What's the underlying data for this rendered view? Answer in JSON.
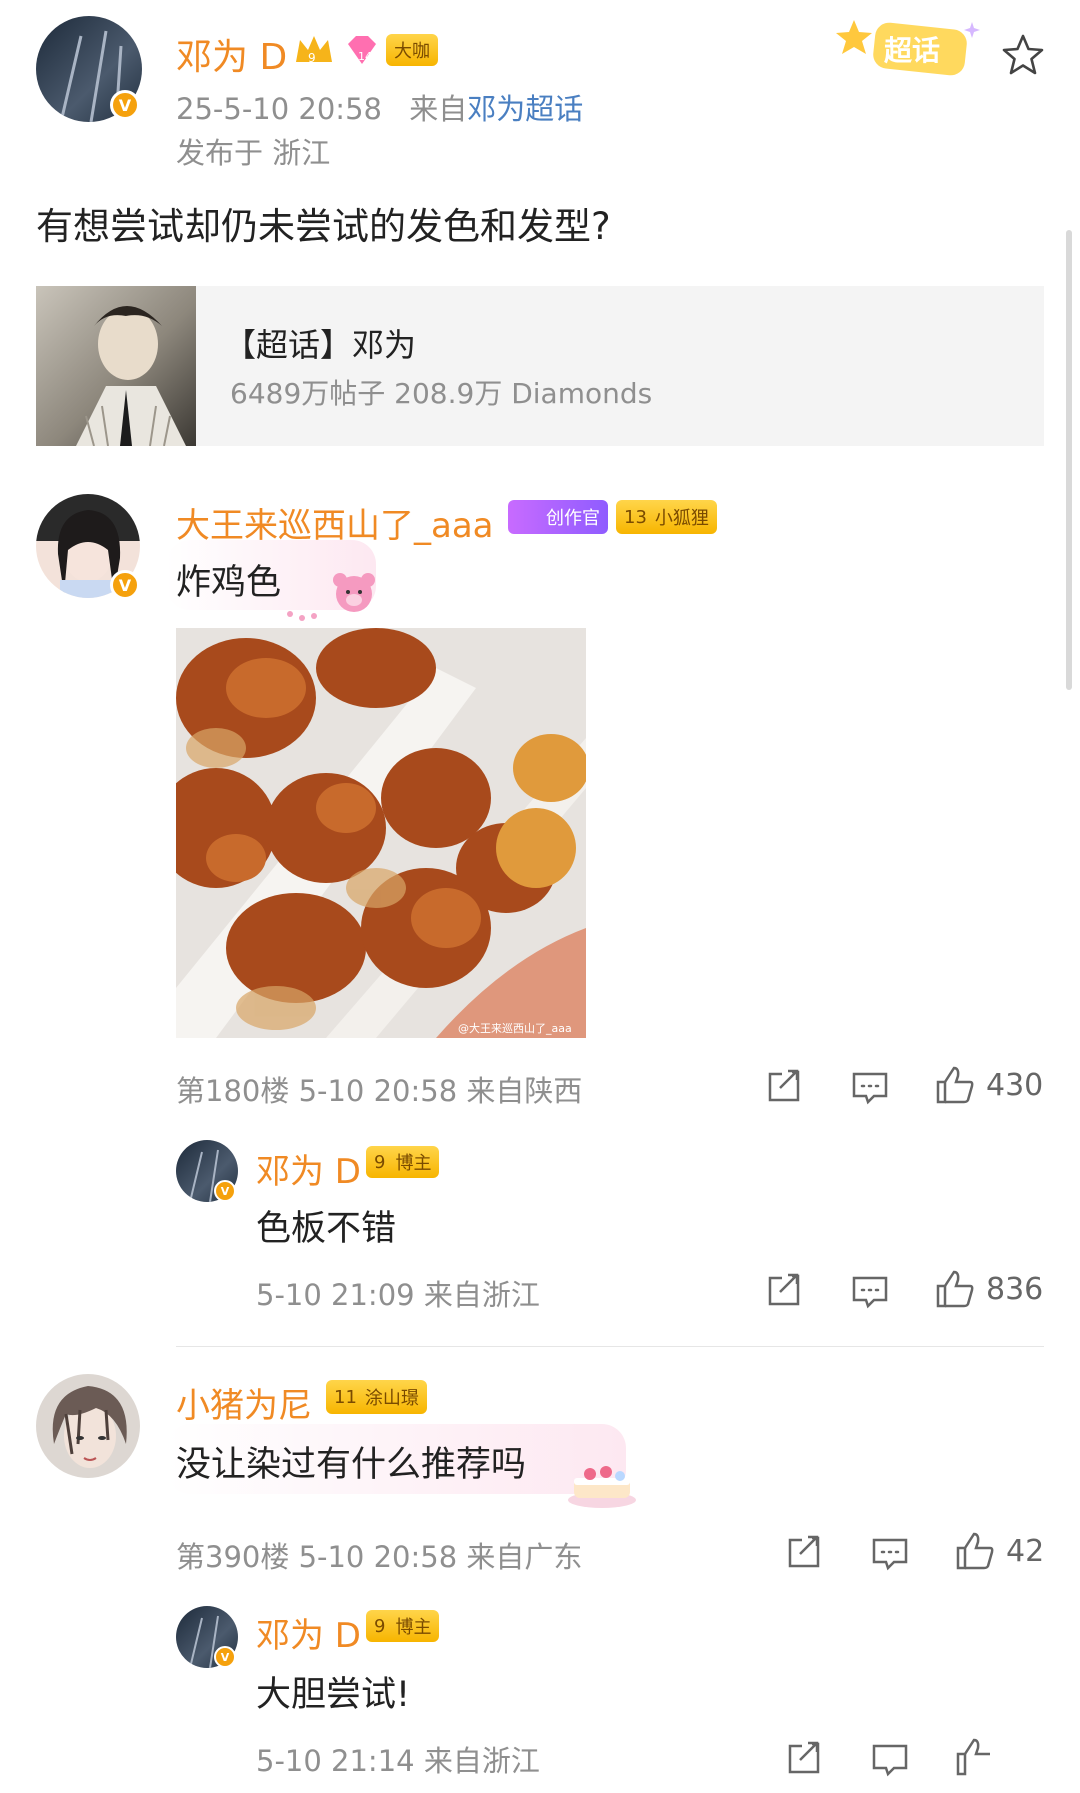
{
  "post": {
    "author": "邓为 D",
    "level_badge": "9",
    "member_badge": "14",
    "tag_badge": "大咖",
    "time": "25-5-10 20:58",
    "source_prefix": "来自",
    "source_link": "邓为超话",
    "published_at": "发布于 浙江",
    "supertopic_tag": "超话",
    "text": "有想尝试却仍未尝试的发色和发型?",
    "topic_card": {
      "title": "【超话】邓为",
      "stats": "6489万帖子 208.9万 Diamonds"
    }
  },
  "comments": [
    {
      "user": "大王来巡西山了_aaa",
      "badge1": "创作官",
      "badge2_level": "13",
      "badge2_label": "小狐狸",
      "text": "炸鸡色",
      "image_watermark": "@大王来巡西山了_aaa",
      "floor_info": "第180楼 5-10 20:58 来自陕西",
      "likes": "430",
      "reply": {
        "user": "邓为 D",
        "badge": "博主",
        "badge_level": "9",
        "text": "色板不错",
        "meta": "5-10 21:09 来自浙江",
        "likes": "836"
      }
    },
    {
      "user": "小猪为尼",
      "badge_level": "11",
      "badge_label": "涂山璟",
      "text": "没让染过有什么推荐吗",
      "floor_info": "第390楼 5-10 20:58 来自广东",
      "likes": "42",
      "reply": {
        "user": "邓为 D",
        "badge": "博主",
        "badge_level": "9",
        "text": "大胆尝试!",
        "meta": "5-10 21:14 来自浙江"
      }
    }
  ],
  "colors": {
    "name_orange": "#f08a24",
    "link_blue": "#4a7fc1",
    "meta_gray": "#8f8f8f",
    "card_bg": "#f4f4f4"
  },
  "icons": [
    "verified-icon",
    "star-icon",
    "share-icon",
    "comment-icon",
    "like-icon"
  ]
}
